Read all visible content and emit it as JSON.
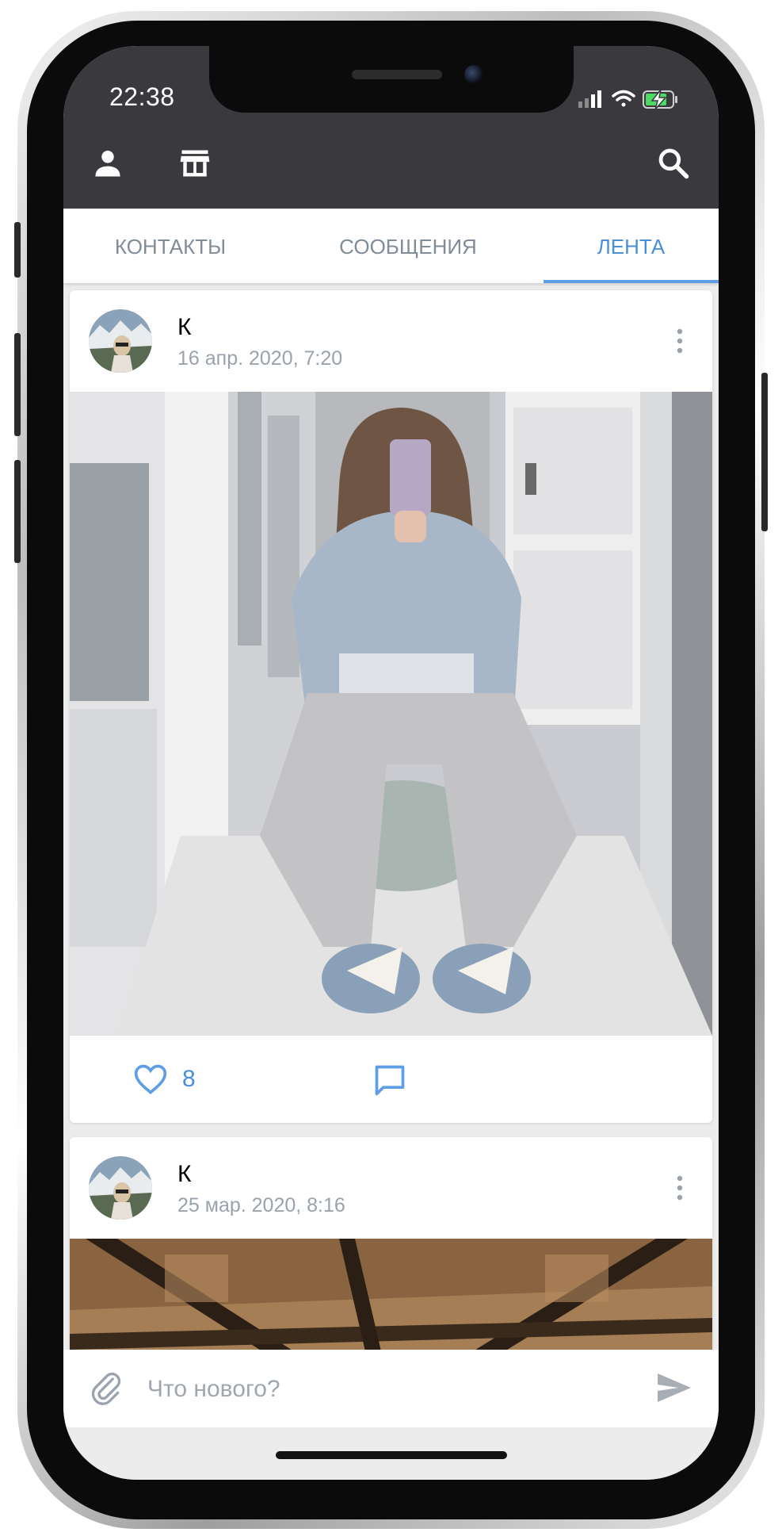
{
  "status_bar": {
    "time": "22:38"
  },
  "toolbar": {
    "profile_icon": "person-icon",
    "store_icon": "store-icon",
    "search_icon": "search-icon"
  },
  "tabs": [
    {
      "label": "КОНТАКТЫ",
      "active": false
    },
    {
      "label": "СООБЩЕНИЯ",
      "active": false
    },
    {
      "label": "ЛЕНТА",
      "active": true
    }
  ],
  "posts": [
    {
      "author": "К",
      "date": "16 апр. 2020, 7:20",
      "likes": "8"
    },
    {
      "author": "К",
      "date": "25 мар. 2020, 8:16"
    }
  ],
  "composer": {
    "placeholder": "Что нового?"
  },
  "colors": {
    "accent": "#4a90d9",
    "topbar": "#3a3a3e",
    "muted_text": "#9aa2ac",
    "tab_inactive": "#818c99"
  }
}
